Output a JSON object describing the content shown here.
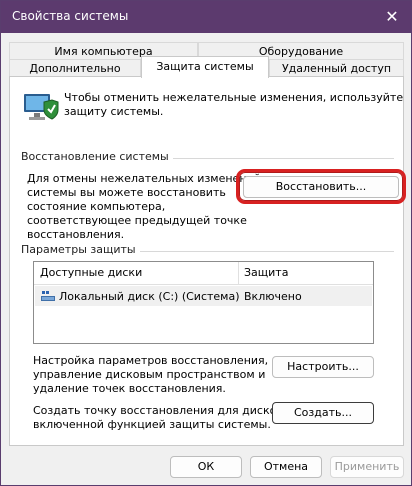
{
  "window": {
    "title": "Свойства системы",
    "close_glyph": "✕"
  },
  "tabs": {
    "row1": [
      "Имя компьютера",
      "Оборудование"
    ],
    "row2": [
      "Дополнительно",
      "Защита системы",
      "Удаленный доступ"
    ],
    "active": "Защита системы"
  },
  "intro": {
    "line1": "Чтобы отменить нежелательные изменения, используйте",
    "line2": "защиту системы.",
    "icon": "computer-shield-icon"
  },
  "restore_section": {
    "title": "Восстановление системы",
    "desc_lines": [
      "Для отмены нежелательных изменений",
      "системы вы можете восстановить",
      "состояние компьютера,",
      "соответствующее предыдущей точке",
      "восстановления."
    ],
    "button": "Восстановить...",
    "highlight_color": "#d82121"
  },
  "protection_section": {
    "title": "Параметры защиты",
    "columns": [
      "Доступные диски",
      "Защита"
    ],
    "rows": [
      {
        "name": "Локальный диск (C:) (Система)",
        "protection": "Включено",
        "icon": "drive-icon"
      }
    ],
    "configure_desc": [
      "Настройка параметров восстановления,",
      "управление дисковым пространством и",
      "удаление точек восстановления."
    ],
    "configure_button": "Настроить...",
    "create_desc": [
      "Создать точку восстановления для дисков с",
      "включенной функцией защиты системы."
    ],
    "create_button": "Создать..."
  },
  "footer": {
    "ok": "ОК",
    "cancel": "Отмена",
    "apply": "Применить"
  },
  "colors": {
    "titlebar": "#5c3a6e",
    "accent": "#0067c0"
  }
}
